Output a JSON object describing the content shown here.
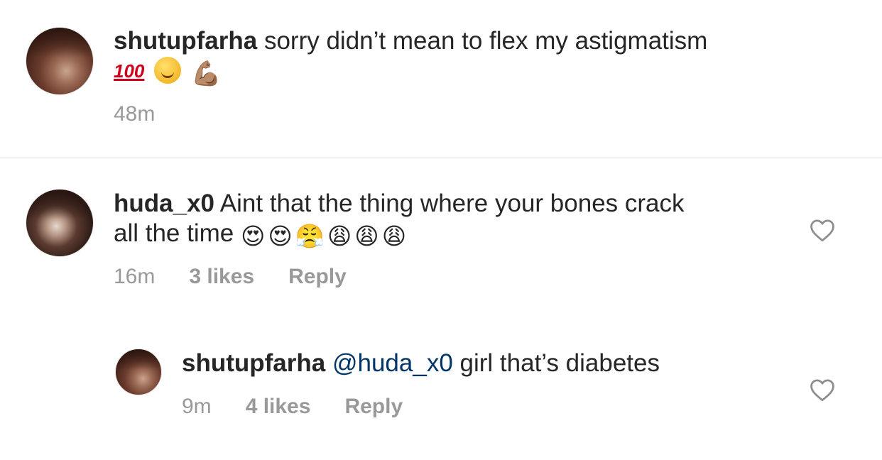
{
  "caption": {
    "username": "shutupfarha",
    "text": "sorry didn’t mean to flex my astigmatism",
    "emojis": [
      "💯",
      "😏",
      "💪🏽"
    ],
    "time": "48m"
  },
  "comments": [
    {
      "username": "huda_x0",
      "text_line1": "Aint that the thing where your bones crack",
      "text_line2": "all the time",
      "emojis": [
        "😍",
        "😍",
        "😤",
        "😩",
        "😩",
        "😩"
      ],
      "time": "16m",
      "likes": "3 likes",
      "reply_label": "Reply"
    },
    {
      "username": "shutupfarha",
      "mention": "@huda_x0",
      "text": "girl that’s diabetes",
      "time": "9m",
      "likes": "4 likes",
      "reply_label": "Reply"
    }
  ],
  "colors": {
    "username": "#262626",
    "mention": "#003569",
    "meta": "#999999",
    "divider": "#dbdbdb"
  }
}
